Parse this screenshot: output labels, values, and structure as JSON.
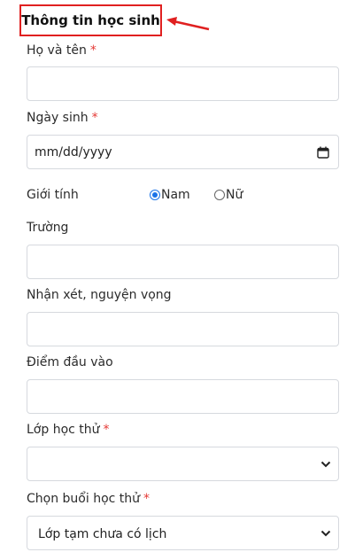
{
  "form": {
    "section_title": "Thông tin học sinh",
    "required_mark": "*",
    "fullname": {
      "label": "Họ và tên",
      "value": ""
    },
    "birthday": {
      "label": "Ngày sinh",
      "placeholder": "mm/dd/yyyy"
    },
    "gender": {
      "label": "Giới tính",
      "options": [
        "Nam",
        "Nữ"
      ],
      "selected": "Nam"
    },
    "school": {
      "label": "Trường",
      "value": ""
    },
    "comments": {
      "label": "Nhận xét, nguyện vọng",
      "value": ""
    },
    "entrance_score": {
      "label": "Điểm đầu vào",
      "value": ""
    },
    "trial_class": {
      "label": "Lớp học thử",
      "selected": ""
    },
    "trial_session": {
      "label": "Chọn buổi học thử",
      "selected": "Lớp tạm chưa có lịch"
    }
  },
  "colors": {
    "accent": "#1a73e8",
    "annotation_red": "#e02020",
    "required": "#e53935",
    "border": "#d6d9de"
  },
  "icons": [
    "calendar-icon",
    "chevron-down-icon",
    "annotation-arrow-icon"
  ]
}
